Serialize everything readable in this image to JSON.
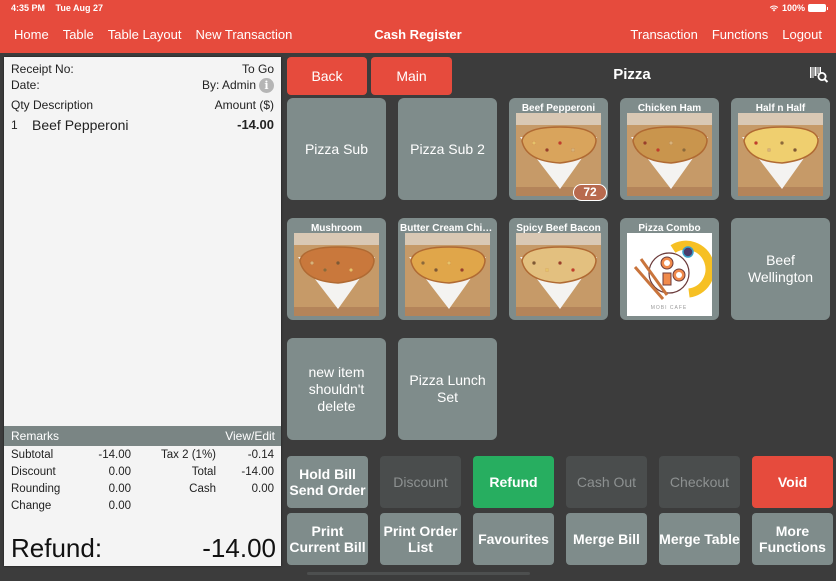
{
  "status_bar": {
    "time": "4:35 PM",
    "date": "Tue Aug 27",
    "battery": "100%"
  },
  "nav": {
    "left": [
      "Home",
      "Table",
      "Table Layout",
      "New Transaction"
    ],
    "title": "Cash Register",
    "right": [
      "Transaction",
      "Functions",
      "Logout"
    ]
  },
  "receipt": {
    "receipt_no_label": "Receipt No:",
    "order_type": "To Go",
    "date_label": "Date:",
    "by_label": "By: Admin",
    "col_qty": "Qty",
    "col_desc": "Description",
    "col_amount": "Amount ($)",
    "items": [
      {
        "qty": "1",
        "description": "Beef Pepperoni",
        "amount": "-14.00"
      }
    ],
    "remarks_label": "Remarks",
    "remarks_action": "View/Edit",
    "totals": {
      "subtotal_label": "Subtotal",
      "subtotal": "-14.00",
      "tax_label": "Tax 2 (1%)",
      "tax": "-0.14",
      "discount_label": "Discount",
      "discount": "0.00",
      "total_label": "Total",
      "total": "-14.00",
      "rounding_label": "Rounding",
      "rounding": "0.00",
      "cash_label": "Cash",
      "cash": "0.00",
      "change_label": "Change",
      "change": "0.00"
    },
    "refund_label": "Refund:",
    "refund_amount": "-14.00"
  },
  "menu_header": {
    "back": "Back",
    "main": "Main",
    "category": "Pizza",
    "barcode_icon": "barcode-search-icon"
  },
  "menu_tiles": [
    {
      "label": "Pizza Sub",
      "type": "text"
    },
    {
      "label": "Pizza Sub 2",
      "type": "text"
    },
    {
      "label": "Beef Pepperoni",
      "type": "image",
      "badge": "72"
    },
    {
      "label": "Chicken Ham",
      "type": "image"
    },
    {
      "label": "Half n Half",
      "type": "image"
    },
    {
      "label": "Mushroom",
      "type": "image"
    },
    {
      "label": "Butter Cream Chic...",
      "type": "image"
    },
    {
      "label": "Spicy Beef Bacon",
      "type": "image"
    },
    {
      "label": "Pizza Combo",
      "type": "logo",
      "logo_text": "MOBI CAFE"
    },
    {
      "label": "Beef Wellington",
      "type": "text"
    },
    {
      "label": "new item shouldn't delete",
      "type": "text"
    },
    {
      "label": "Pizza Lunch Set",
      "type": "text"
    }
  ],
  "function_buttons": [
    {
      "label": "Hold Bill Send Order",
      "state": "normal"
    },
    {
      "label": "Discount",
      "state": "disabled"
    },
    {
      "label": "Refund",
      "state": "active-green"
    },
    {
      "label": "Cash Out",
      "state": "disabled"
    },
    {
      "label": "Checkout",
      "state": "disabled"
    },
    {
      "label": "Void",
      "state": "danger"
    },
    {
      "label": "Print Current Bill",
      "state": "normal"
    },
    {
      "label": "Print Order List",
      "state": "normal"
    },
    {
      "label": "Favourites",
      "state": "normal"
    },
    {
      "label": "Merge Bill",
      "state": "normal"
    },
    {
      "label": "Merge Table",
      "state": "normal"
    },
    {
      "label": "More Functions",
      "state": "normal"
    }
  ],
  "colors": {
    "brand_red": "#e64b3d",
    "tile_gray": "#7f8c8b",
    "refund_green": "#27ae60",
    "background": "#3c3c3c"
  }
}
